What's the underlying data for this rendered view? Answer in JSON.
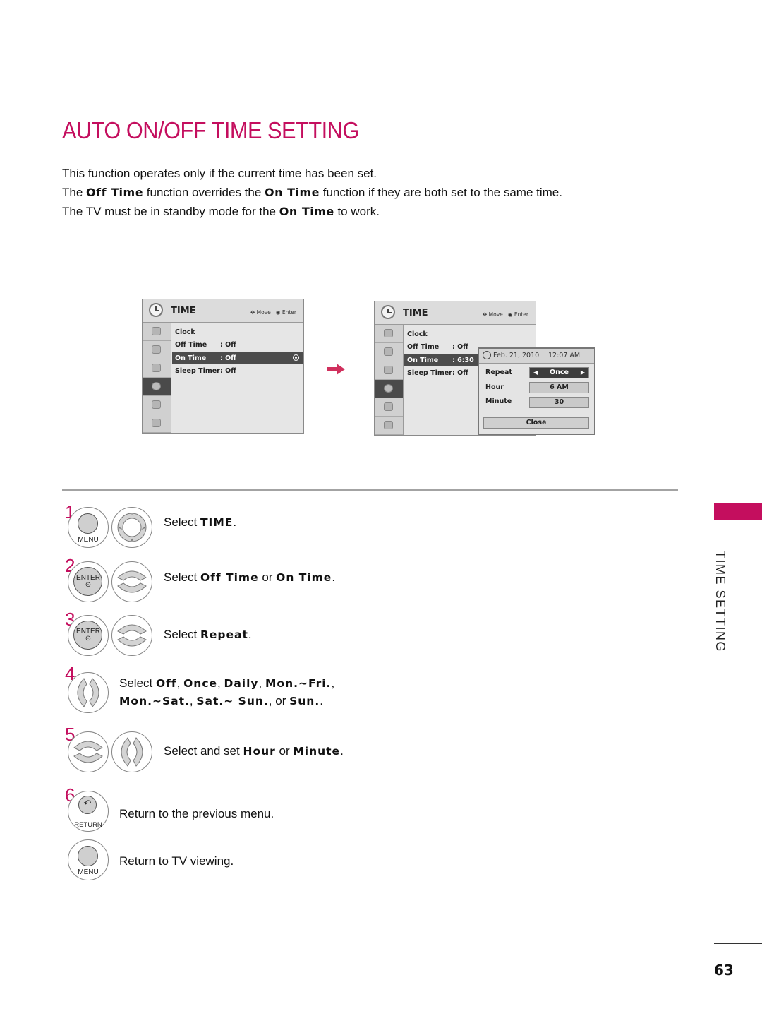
{
  "page": {
    "title": "AUTO ON/OFF TIME SETTING",
    "intro": [
      {
        "pre": "This function operates only if the current time has been set.",
        "b1": "",
        "mid": "",
        "b2": "",
        "post": ""
      },
      {
        "pre": "The ",
        "b1": "Off Time",
        "mid": " function overrides the ",
        "b2": "On Time",
        "post": " function if they are both set to the same time."
      },
      {
        "pre": "The TV must be in standby mode for the ",
        "b1": "On Time",
        "mid": " to work.",
        "b2": "",
        "post": ""
      }
    ],
    "section_tab": "TIME SETTING",
    "page_number": "63",
    "accent_color": "#c40e5e"
  },
  "menu1": {
    "title": "TIME",
    "hint_move": "Move",
    "hint_enter": "Enter",
    "items": [
      {
        "label": "Clock",
        "value": ""
      },
      {
        "label": "Off Time",
        "value": ": Off"
      },
      {
        "label": "On Time",
        "value": ": Off",
        "selected": true
      },
      {
        "label": "Sleep Timer",
        "value": ": Off"
      }
    ]
  },
  "menu2": {
    "title": "TIME",
    "hint_move": "Move",
    "hint_enter": "Enter",
    "items": [
      {
        "label": "Clock",
        "value": ""
      },
      {
        "label": "Off Time",
        "value": ": Off"
      },
      {
        "label": "On Time",
        "value": ": 6:30",
        "selected": true
      },
      {
        "label": "Sleep Timer",
        "value": ": Off"
      }
    ],
    "popup": {
      "date": "Feb. 21, 2010",
      "time": "12:07 AM",
      "repeat_label": "Repeat",
      "repeat_value": "Once",
      "hour_label": "Hour",
      "hour_value": "6 AM",
      "minute_label": "Minute",
      "minute_value": "30",
      "close_label": "Close"
    }
  },
  "steps": [
    {
      "num": "1",
      "buttons": [
        "MENU",
        "nav-pad"
      ],
      "pre": "Select ",
      "parts": [
        {
          "b": "TIME"
        },
        {
          "t": "."
        }
      ]
    },
    {
      "num": "2",
      "buttons": [
        "ENTER",
        "up-down"
      ],
      "pre": "Select ",
      "parts": [
        {
          "b": "Off Time"
        },
        {
          "t": " or "
        },
        {
          "b": "On Time"
        },
        {
          "t": "."
        }
      ]
    },
    {
      "num": "3",
      "buttons": [
        "ENTER",
        "up-down"
      ],
      "pre": "Select ",
      "parts": [
        {
          "b": "Repeat"
        },
        {
          "t": "."
        }
      ]
    },
    {
      "num": "4",
      "buttons": [
        "left-right"
      ],
      "line1": "Select ",
      "line1_parts": [
        {
          "b": "Off"
        },
        {
          "t": ", "
        },
        {
          "b": "Once"
        },
        {
          "t": ", "
        },
        {
          "b": "Daily"
        },
        {
          "t": ", "
        },
        {
          "b": "Mon.~Fri."
        },
        {
          "t": ","
        }
      ],
      "line2_parts": [
        {
          "b": "Mon.~Sat."
        },
        {
          "t": ", "
        },
        {
          "b": "Sat.~ Sun."
        },
        {
          "t": ", or "
        },
        {
          "b": "Sun."
        },
        {
          "t": "."
        }
      ]
    },
    {
      "num": "5",
      "buttons": [
        "up-down",
        "left-right"
      ],
      "pre": "Select and set ",
      "parts": [
        {
          "b": "Hour"
        },
        {
          "t": " or "
        },
        {
          "b": "Minute"
        },
        {
          "t": "."
        }
      ]
    },
    {
      "num": "6",
      "buttons": [
        "RETURN"
      ],
      "pre": "Return to the previous menu.",
      "parts": []
    },
    {
      "num": "",
      "buttons": [
        "MENU"
      ],
      "pre": "Return to TV viewing.",
      "parts": []
    }
  ],
  "button_labels": {
    "menu": "MENU",
    "enter": "ENTER",
    "return": "RETURN"
  }
}
